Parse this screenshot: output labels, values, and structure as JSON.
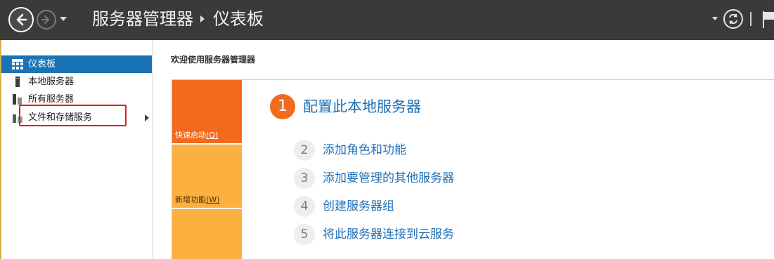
{
  "header": {
    "breadcrumb_root": "服务器管理器",
    "breadcrumb_page": "仪表板"
  },
  "sidebar": {
    "items": [
      {
        "label": "仪表板",
        "icon": "dashboard-icon",
        "active": true
      },
      {
        "label": "本地服务器",
        "icon": "server-icon",
        "active": false
      },
      {
        "label": "所有服务器",
        "icon": "servers-icon",
        "active": false
      },
      {
        "label": "文件和存储服务",
        "icon": "storage-icon",
        "active": false,
        "has_submenu": true
      }
    ]
  },
  "main": {
    "welcome_title": "欢迎使用服务器管理器",
    "tiles": {
      "quick_start": {
        "label": "快速启动",
        "accel": "(Q)"
      },
      "whats_new": {
        "label": "新增功能",
        "accel": "(W)"
      }
    },
    "steps": [
      {
        "num": "1",
        "label": "配置此本地服务器"
      },
      {
        "num": "2",
        "label": "添加角色和功能"
      },
      {
        "num": "3",
        "label": "添加要管理的其他服务器"
      },
      {
        "num": "4",
        "label": "创建服务器组"
      },
      {
        "num": "5",
        "label": "将此服务器连接到云服务"
      }
    ]
  },
  "colors": {
    "titlebar": "#3a3a3a",
    "active": "#1a73b5",
    "accent_orange": "#f26a1b",
    "tile_yellow": "#fbb040",
    "link_blue": "#1f6fb5",
    "highlight_red": "#e0201c"
  }
}
